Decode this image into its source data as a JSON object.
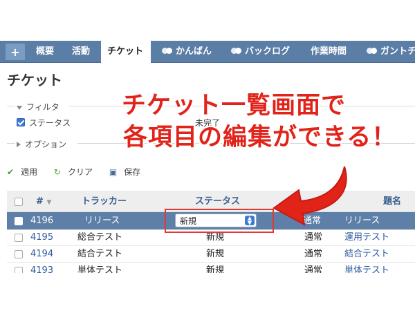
{
  "nav": {
    "plus": "+",
    "tabs": [
      "概要",
      "活動",
      "チケット",
      "かんばん",
      "バックログ",
      "作業時間",
      "ガントチャ"
    ]
  },
  "page": {
    "title": "チケット"
  },
  "filters": {
    "legend": "フィルタ",
    "status_label": "ステータス",
    "partial_value": "未完了",
    "options_legend": "オプション"
  },
  "actions": {
    "apply": "適用",
    "clear": "クリア",
    "save": "保存"
  },
  "table": {
    "headers": {
      "num": "#",
      "tracker": "トラッカー",
      "status": "ステータス",
      "subject": "題名"
    },
    "rows": [
      {
        "id": "4196",
        "tracker": "リリース",
        "status": "新規",
        "priority": "通常",
        "subject": "リリース"
      },
      {
        "id": "4195",
        "tracker": "総合テスト",
        "status": "新規",
        "priority": "通常",
        "subject": "運用テスト"
      },
      {
        "id": "4194",
        "tracker": "結合テスト",
        "status": "新規",
        "priority": "通常",
        "subject": "結合テスト"
      },
      {
        "id": "4193",
        "tracker": "単体テスト",
        "status": "新規",
        "priority": "通常",
        "subject": "単体テスト"
      }
    ]
  },
  "callout": {
    "line1": "チケット一覧画面で",
    "line2": "各項目の編集ができる！",
    "color": "#e2231a"
  }
}
